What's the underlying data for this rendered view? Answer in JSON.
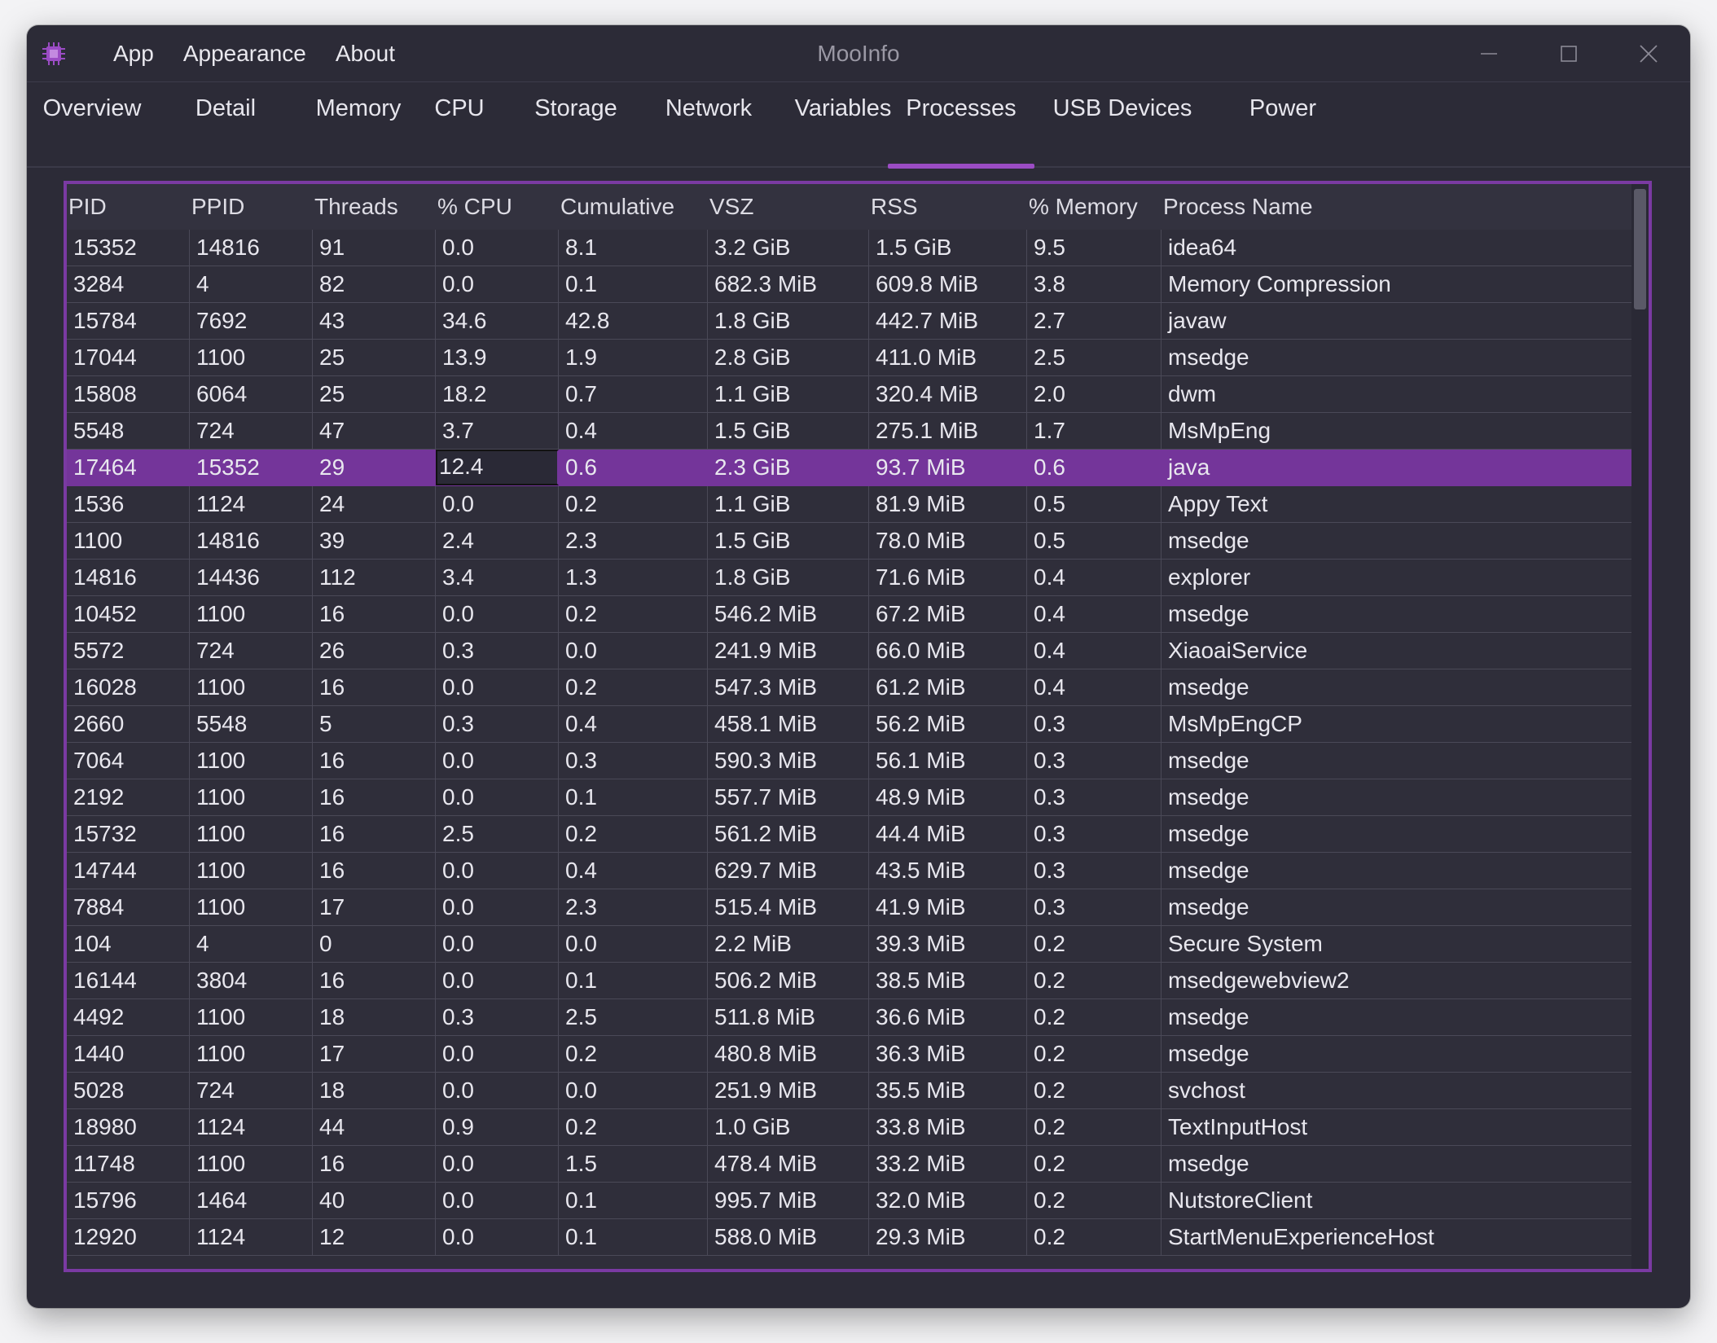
{
  "window": {
    "title": "MooInfo"
  },
  "menu": {
    "items": [
      "App",
      "Appearance",
      "About"
    ]
  },
  "tabs": {
    "items": [
      "Overview",
      "Detail",
      "Memory",
      "CPU",
      "Storage",
      "Network",
      "Variables",
      "Processes",
      "USB Devices",
      "Power"
    ],
    "active": "Processes"
  },
  "table": {
    "columns": [
      "PID",
      "PPID",
      "Threads",
      "% CPU",
      "Cumulative",
      "VSZ",
      "RSS",
      "% Memory",
      "Process Name"
    ],
    "selected_row_index": 6,
    "rows": [
      [
        "15352",
        "14816",
        "91",
        "0.0",
        "8.1",
        "3.2 GiB",
        "1.5 GiB",
        "9.5",
        "idea64"
      ],
      [
        "3284",
        "4",
        "82",
        "0.0",
        "0.1",
        "682.3 MiB",
        "609.8 MiB",
        "3.8",
        "Memory Compression"
      ],
      [
        "15784",
        "7692",
        "43",
        "34.6",
        "42.8",
        "1.8 GiB",
        "442.7 MiB",
        "2.7",
        "javaw"
      ],
      [
        "17044",
        "1100",
        "25",
        "13.9",
        "1.9",
        "2.8 GiB",
        "411.0 MiB",
        "2.5",
        "msedge"
      ],
      [
        "15808",
        "6064",
        "25",
        "18.2",
        "0.7",
        "1.1 GiB",
        "320.4 MiB",
        "2.0",
        "dwm"
      ],
      [
        "5548",
        "724",
        "47",
        "3.7",
        "0.4",
        "1.5 GiB",
        "275.1 MiB",
        "1.7",
        "MsMpEng"
      ],
      [
        "17464",
        "15352",
        "29",
        "12.4",
        "0.6",
        "2.3 GiB",
        "93.7 MiB",
        "0.6",
        "java"
      ],
      [
        "1536",
        "1124",
        "24",
        "0.0",
        "0.2",
        "1.1 GiB",
        "81.9 MiB",
        "0.5",
        "Appy Text"
      ],
      [
        "1100",
        "14816",
        "39",
        "2.4",
        "2.3",
        "1.5 GiB",
        "78.0 MiB",
        "0.5",
        "msedge"
      ],
      [
        "14816",
        "14436",
        "112",
        "3.4",
        "1.3",
        "1.8 GiB",
        "71.6 MiB",
        "0.4",
        "explorer"
      ],
      [
        "10452",
        "1100",
        "16",
        "0.0",
        "0.2",
        "546.2 MiB",
        "67.2 MiB",
        "0.4",
        "msedge"
      ],
      [
        "5572",
        "724",
        "26",
        "0.3",
        "0.0",
        "241.9 MiB",
        "66.0 MiB",
        "0.4",
        "XiaoaiService"
      ],
      [
        "16028",
        "1100",
        "16",
        "0.0",
        "0.2",
        "547.3 MiB",
        "61.2 MiB",
        "0.4",
        "msedge"
      ],
      [
        "2660",
        "5548",
        "5",
        "0.3",
        "0.4",
        "458.1 MiB",
        "56.2 MiB",
        "0.3",
        "MsMpEngCP"
      ],
      [
        "7064",
        "1100",
        "16",
        "0.0",
        "0.3",
        "590.3 MiB",
        "56.1 MiB",
        "0.3",
        "msedge"
      ],
      [
        "2192",
        "1100",
        "16",
        "0.0",
        "0.1",
        "557.7 MiB",
        "48.9 MiB",
        "0.3",
        "msedge"
      ],
      [
        "15732",
        "1100",
        "16",
        "2.5",
        "0.2",
        "561.2 MiB",
        "44.4 MiB",
        "0.3",
        "msedge"
      ],
      [
        "14744",
        "1100",
        "16",
        "0.0",
        "0.4",
        "629.7 MiB",
        "43.5 MiB",
        "0.3",
        "msedge"
      ],
      [
        "7884",
        "1100",
        "17",
        "0.0",
        "2.3",
        "515.4 MiB",
        "41.9 MiB",
        "0.3",
        "msedge"
      ],
      [
        "104",
        "4",
        "0",
        "0.0",
        "0.0",
        "2.2 MiB",
        "39.3 MiB",
        "0.2",
        "Secure System"
      ],
      [
        "16144",
        "3804",
        "16",
        "0.0",
        "0.1",
        "506.2 MiB",
        "38.5 MiB",
        "0.2",
        "msedgewebview2"
      ],
      [
        "4492",
        "1100",
        "18",
        "0.3",
        "2.5",
        "511.8 MiB",
        "36.6 MiB",
        "0.2",
        "msedge"
      ],
      [
        "1440",
        "1100",
        "17",
        "0.0",
        "0.2",
        "480.8 MiB",
        "36.3 MiB",
        "0.2",
        "msedge"
      ],
      [
        "5028",
        "724",
        "18",
        "0.0",
        "0.0",
        "251.9 MiB",
        "35.5 MiB",
        "0.2",
        "svchost"
      ],
      [
        "18980",
        "1124",
        "44",
        "0.9",
        "0.2",
        "1.0 GiB",
        "33.8 MiB",
        "0.2",
        "TextInputHost"
      ],
      [
        "11748",
        "1100",
        "16",
        "0.0",
        "1.5",
        "478.4 MiB",
        "33.2 MiB",
        "0.2",
        "msedge"
      ],
      [
        "15796",
        "1464",
        "40",
        "0.0",
        "0.1",
        "995.7 MiB",
        "32.0 MiB",
        "0.2",
        "NutstoreClient"
      ],
      [
        "12920",
        "1124",
        "12",
        "0.0",
        "0.1",
        "588.0 MiB",
        "29.3 MiB",
        "0.2",
        "StartMenuExperienceHost"
      ]
    ]
  },
  "colors": {
    "accent": "#9b4cc4",
    "selected_row": "#74359a",
    "background": "#2c2b37"
  }
}
